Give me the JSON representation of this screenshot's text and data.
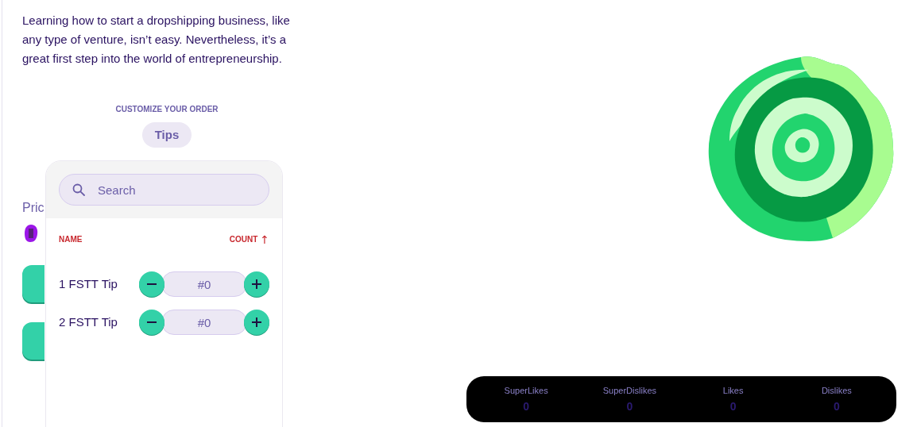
{
  "intro": "Learning how to start a dropshipping business, like any type of venture, isn’t easy. Nevertheless, it’s a great first step into the world of entrepreneurship.",
  "customize": {
    "heading": "CUSTOMIZE YOUR ORDER",
    "tabs": [
      {
        "label": "Tips",
        "selected": true
      }
    ]
  },
  "background": {
    "price_label": "Pric"
  },
  "tips_panel": {
    "search": {
      "placeholder": "Search"
    },
    "columns": [
      {
        "label": "NAME"
      },
      {
        "label": "COUNT",
        "sort_arrow": "↑"
      }
    ],
    "rows": [
      {
        "name": "1 FSTT Tip",
        "value": "#0"
      },
      {
        "name": "2 FSTT Tip",
        "value": "#0"
      }
    ]
  },
  "stats": [
    {
      "label": "SuperLikes",
      "value": "0"
    },
    {
      "label": "SuperDislikes",
      "value": "0"
    },
    {
      "label": "Likes",
      "value": "0"
    },
    {
      "label": "Dislikes",
      "value": "0"
    }
  ]
}
